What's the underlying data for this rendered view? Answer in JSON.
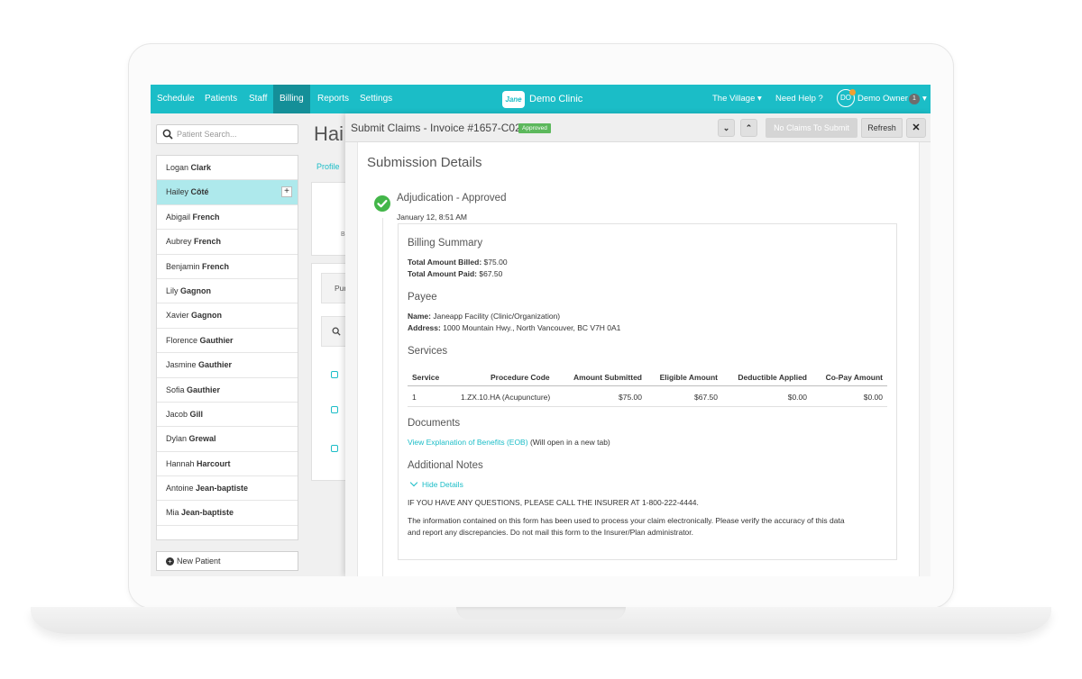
{
  "nav": {
    "items": [
      "Schedule",
      "Patients",
      "Staff",
      "Billing",
      "Reports",
      "Settings"
    ],
    "active": "Billing",
    "brand": "Demo Clinic",
    "logo_text": "Jane",
    "location": "The Village",
    "help": "Need Help ?",
    "avatar_initials": "DO",
    "user": "Demo Owner",
    "notification_count": "1"
  },
  "sidebar": {
    "search_placeholder": "Patient Search...",
    "patients": [
      {
        "first": "Logan",
        "last": "Clark"
      },
      {
        "first": "Hailey",
        "last": "Côté",
        "selected": true
      },
      {
        "first": "Abigail",
        "last": "French"
      },
      {
        "first": "Aubrey",
        "last": "French"
      },
      {
        "first": "Benjamin",
        "last": "French"
      },
      {
        "first": "Lily",
        "last": "Gagnon"
      },
      {
        "first": "Xavier",
        "last": "Gagnon"
      },
      {
        "first": "Florence",
        "last": "Gauthier"
      },
      {
        "first": "Jasmine",
        "last": "Gauthier"
      },
      {
        "first": "Sofia",
        "last": "Gauthier"
      },
      {
        "first": "Jacob",
        "last": "Gill"
      },
      {
        "first": "Dylan",
        "last": "Grewal"
      },
      {
        "first": "Hannah",
        "last": "Harcourt"
      },
      {
        "first": "Antoine",
        "last": "Jean-baptiste"
      },
      {
        "first": "Mia",
        "last": "Jean-baptiste"
      }
    ],
    "new_patient": "New Patient"
  },
  "background": {
    "title": "Hai",
    "profile_link": "Profile",
    "letter_b": "B",
    "pur_text": "Pur"
  },
  "modal": {
    "title": "Submit Claims - Invoice #1657-C02",
    "status_badge": "Approved",
    "no_claims": "No Claims To Submit",
    "refresh": "Refresh",
    "section_title": "Submission Details",
    "adjudication_title": "Adjudication - Approved",
    "adjudication_date": "January 12, 8:51 AM",
    "billing_summary": {
      "heading": "Billing Summary",
      "billed_label": "Total Amount Billed:",
      "billed_value": "$75.00",
      "paid_label": "Total Amount Paid:",
      "paid_value": "$67.50"
    },
    "payee": {
      "heading": "Payee",
      "name_label": "Name:",
      "name_value": "Janeapp Facility (Clinic/Organization)",
      "address_label": "Address:",
      "address_value": "1000 Mountain Hwy., North Vancouver, BC V7H 0A1"
    },
    "services": {
      "heading": "Services",
      "columns": [
        "Service",
        "Procedure Code",
        "Amount Submitted",
        "Eligible Amount",
        "Deductible Applied",
        "Co-Pay Amount"
      ],
      "rows": [
        [
          "1",
          "1.ZX.10.HA (Acupuncture)",
          "$75.00",
          "$67.50",
          "$0.00",
          "$0.00"
        ]
      ]
    },
    "documents": {
      "heading": "Documents",
      "link": "View Explanation of Benefits (EOB)",
      "note": "(Will open in a new tab)"
    },
    "notes": {
      "heading": "Additional Notes",
      "toggle": "Hide Details",
      "line1": "IF YOU HAVE ANY QUESTIONS, PLEASE CALL THE INSURER AT 1-800-222-4444.",
      "line2": "The information contained on this form has been used to process your claim electronically. Please verify the accuracy of this data",
      "line3": "and report any discrepancies. Do not mail this form to the Insurer/Plan administrator."
    }
  },
  "colors": {
    "brand": "#1bbdc7",
    "nav_active": "#148f98",
    "approved": "#5cb85c",
    "selected_row": "#aee9ec"
  }
}
